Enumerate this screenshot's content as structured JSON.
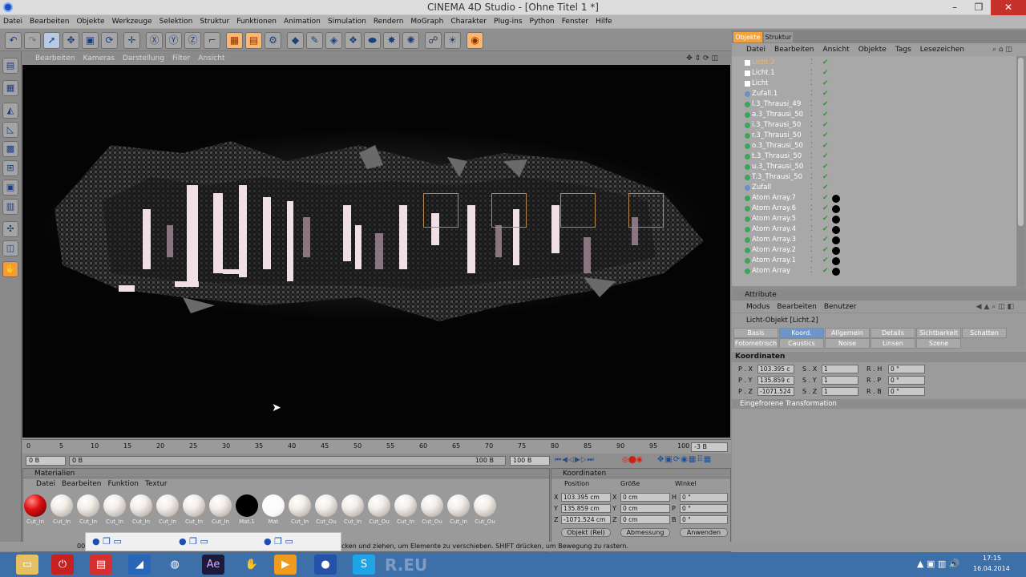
{
  "window": {
    "title": "CINEMA 4D Studio - [Ohne Titel 1 *]"
  },
  "menu": [
    "Datei",
    "Bearbeiten",
    "Objekte",
    "Werkzeuge",
    "Selektion",
    "Struktur",
    "Funktionen",
    "Animation",
    "Simulation",
    "Rendern",
    "MoGraph",
    "Charakter",
    "Plug-ins",
    "Python",
    "Fenster",
    "Hilfe"
  ],
  "viewport": {
    "menu": [
      "Bearbeiten",
      "Kameras",
      "Darstellung",
      "Filter",
      "Ansicht"
    ]
  },
  "timeline": {
    "ticks": [
      "0",
      "5",
      "10",
      "15",
      "20",
      "25",
      "30",
      "35",
      "40",
      "45",
      "50",
      "55",
      "60",
      "65",
      "70",
      "75",
      "80",
      "85",
      "90",
      "95",
      "100"
    ],
    "current": "-3 B",
    "start": "0 B",
    "min": "0 B",
    "max": "100 B",
    "end": "100 B"
  },
  "materials": {
    "title": "Materialien",
    "menu": [
      "Datei",
      "Bearbeiten",
      "Funktion",
      "Textur"
    ],
    "items": [
      "Cut_In",
      "Cut_In",
      "Cut_In",
      "Cut_In",
      "Cut_In",
      "Cut_In",
      "Cut_In",
      "Cut_In",
      "Mat.1",
      "Mat",
      "Cut_In",
      "Cut_Ou",
      "Cut_In",
      "Cut_Ou",
      "Cut_In",
      "Cut_Ou",
      "Cut_In",
      "Cut_Ou"
    ]
  },
  "coordinates": {
    "title": "Koordinaten",
    "headers": [
      "Position",
      "Größe",
      "Winkel"
    ],
    "rows": [
      {
        "axis": "X",
        "pos": "103.395 cm",
        "size_axis": "X",
        "size": "0 cm",
        "ang_axis": "H",
        "ang": "0 °"
      },
      {
        "axis": "Y",
        "pos": "135.859 cm",
        "size_axis": "Y",
        "size": "0 cm",
        "ang_axis": "P",
        "ang": "0 °"
      },
      {
        "axis": "Z",
        "pos": "-1071.524 cm",
        "size_axis": "Z",
        "size": "0 cm",
        "ang_axis": "B",
        "ang": "0 °"
      }
    ],
    "mode": "Objekt (Rel)",
    "size_mode": "Abmessung",
    "apply": "Anwenden"
  },
  "objects": {
    "tabs": [
      "Objekte",
      "Struktur"
    ],
    "menu": [
      "Datei",
      "Bearbeiten",
      "Ansicht",
      "Objekte",
      "Tags",
      "Lesezeichen"
    ],
    "items": [
      "Licht.2",
      "Licht.1",
      "Licht",
      "Zufall.1",
      "l.3_Thrausi_49",
      "a.3_Thrausi_50",
      "i.3_Thrausi_50",
      "r.3_Thrausi_50",
      "o.3_Thrausi_50",
      "t.3_Thrausi_50",
      "u.3_Thrausi_50",
      "T.3_Thrausi_50",
      "Zufall",
      "Atom Array.7",
      "Atom Array.6",
      "Atom Array.5",
      "Atom Array.4",
      "Atom Array.3",
      "Atom Array.2",
      "Atom Array.1",
      "Atom Array"
    ]
  },
  "attributes": {
    "title": "Attribute",
    "menu": [
      "Modus",
      "Bearbeiten",
      "Benutzer"
    ],
    "object": "Licht-Objekt [Licht.2]",
    "tabs_row1": [
      "Basis",
      "Koord.",
      "Allgemein",
      "Details",
      "Sichtbarkeit",
      "Schatten"
    ],
    "tabs_row2": [
      "Fotometrisch",
      "Caustics",
      "Noise",
      "Linsen",
      "Szene"
    ],
    "section": "Koordinaten",
    "rows": [
      {
        "p": "P . X",
        "pv": "103.395 c",
        "s": "S . X",
        "sv": "1",
        "r": "R . H",
        "rv": "0 °"
      },
      {
        "p": "P . Y",
        "pv": "135.859 c",
        "s": "S . Y",
        "sv": "1",
        "r": "R . P",
        "rv": "0 °"
      },
      {
        "p": "P . Z",
        "pv": "-1071.524",
        "s": "S . Z",
        "sv": "1",
        "r": "R . B",
        "rv": "0 °"
      }
    ],
    "frozen": "Eingefrorene Transformation"
  },
  "status": {
    "text": "cken und ziehen, um Elemente zu verschieben. SHIFT drücken, um Bewegung zu rastern.",
    "left": "00"
  },
  "taskbar": {
    "time": "17:15",
    "date": "16.04.2014",
    "faded": "R.EU"
  }
}
